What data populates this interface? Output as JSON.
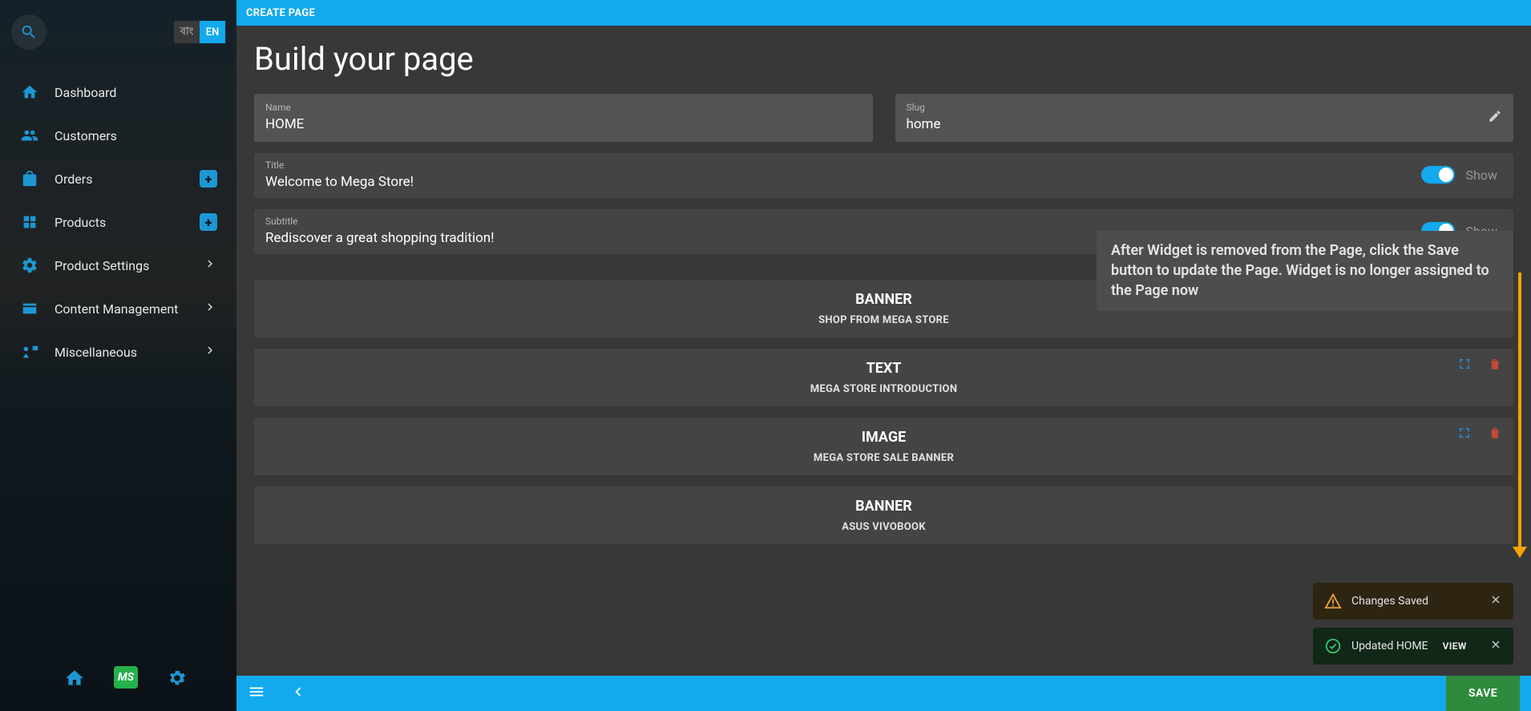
{
  "topbar": {
    "title": "CREATE PAGE"
  },
  "lang": {
    "bn": "বাং",
    "en": "EN"
  },
  "sidebar": {
    "items": [
      {
        "label": "Dashboard"
      },
      {
        "label": "Customers"
      },
      {
        "label": "Orders"
      },
      {
        "label": "Products"
      },
      {
        "label": "Product Settings"
      },
      {
        "label": "Content Management"
      },
      {
        "label": "Miscellaneous"
      }
    ],
    "footer_ms": "MS"
  },
  "page": {
    "heading": "Build your page",
    "name_label": "Name",
    "name_value": "HOME",
    "slug_label": "Slug",
    "slug_value": "home",
    "title_label": "Title",
    "title_value": "Welcome to Mega Store!",
    "subtitle_label": "Subtitle",
    "subtitle_value": "Rediscover a great shopping tradition!",
    "show_label": "Show"
  },
  "tooltip": "After Widget is removed from the Page, click the Save button to update the Page. Widget is no longer assigned to the Page now",
  "widgets": [
    {
      "type": "BANNER",
      "name": "SHOP FROM MEGA STORE"
    },
    {
      "type": "TEXT",
      "name": "MEGA STORE INTRODUCTION"
    },
    {
      "type": "IMAGE",
      "name": "MEGA STORE SALE BANNER"
    },
    {
      "type": "BANNER",
      "name": "ASUS VIVOBOOK"
    }
  ],
  "toasts": {
    "warn": "Changes Saved",
    "ok": "Updated HOME",
    "view": "VIEW"
  },
  "bottombar": {
    "save": "SAVE"
  }
}
